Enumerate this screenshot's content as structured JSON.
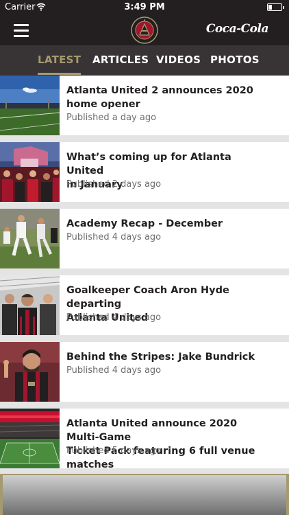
{
  "status_bar": {
    "carrier": "Carrier",
    "time": "3:49 PM",
    "battery_level": 0.25
  },
  "nav": {
    "menu_icon": "hamburger-menu-icon",
    "crest_letter": "A",
    "crest_text": "ATLANTA UNITED FC",
    "sponsor": "Coca-Cola"
  },
  "tabs": [
    {
      "label": "LATEST",
      "active": true
    },
    {
      "label": "ARTICLES",
      "active": false
    },
    {
      "label": "VIDEOS",
      "active": false
    },
    {
      "label": "PHOTOS",
      "active": false
    }
  ],
  "colors": {
    "header": "#231f20",
    "tab_bar": "#383436",
    "accent_gold": "#a59a6f",
    "brand_red": "#a1162d",
    "background": "#e4e4e4"
  },
  "news": [
    {
      "title_line1": "Atlanta United 2 announces 2020",
      "title_line2": "home opener",
      "published": "Published a day ago",
      "thumb": "stadium-photo"
    },
    {
      "title_line1": "What’s coming up for Atlanta United",
      "title_line2": "in January",
      "published": "Published 2 days ago",
      "thumb": "fans-photo"
    },
    {
      "title_line1": "Academy Recap - December",
      "title_line2": "",
      "published": "Published 4 days ago",
      "thumb": "academy-match-photo"
    },
    {
      "title_line1": "Goalkeeper Coach Aron Hyde departing",
      "title_line2": "Atlanta United",
      "published": "Published 4 days ago",
      "thumb": "coach-photo"
    },
    {
      "title_line1": "Behind the Stripes: Jake Bundrick",
      "title_line2": "",
      "published": "Published 4 days ago",
      "thumb": "supporter-photo"
    },
    {
      "title_line1": "Atlanta United announce 2020 Multi-Game",
      "title_line2": "Ticket Pack featuring 6 full venue matches",
      "published": "Published 5 days ago",
      "thumb": "stadium-bowl-photo"
    }
  ],
  "feature_banner": "featured-photo"
}
